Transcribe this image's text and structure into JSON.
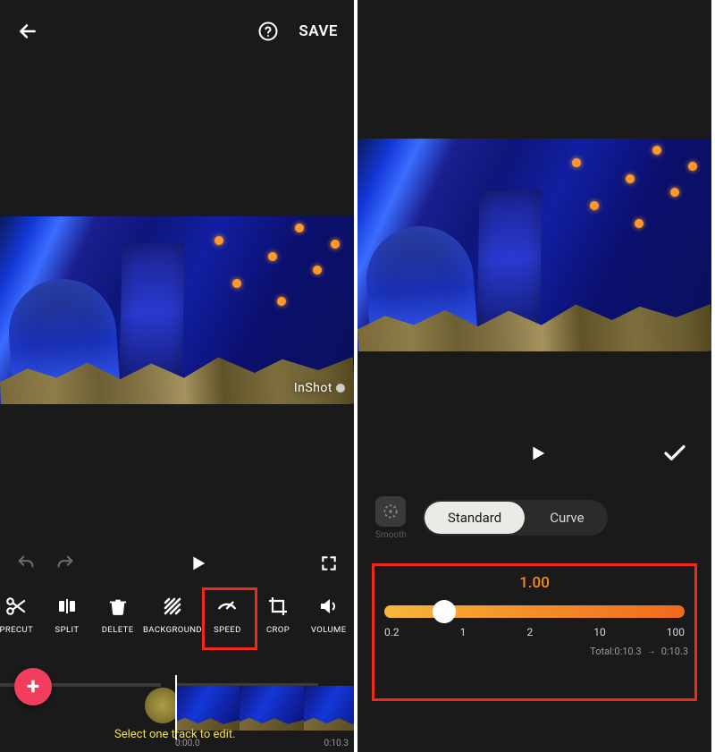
{
  "left": {
    "save_label": "SAVE",
    "watermark": "InShot",
    "tools": [
      {
        "label": "PRECUT"
      },
      {
        "label": "SPLIT"
      },
      {
        "label": "DELETE"
      },
      {
        "label": "BACKGROUND"
      },
      {
        "label": "SPEED"
      },
      {
        "label": "CROP"
      },
      {
        "label": "VOLUME"
      }
    ],
    "hint": "Select one track to edit.",
    "time_start": "0:00.0",
    "time_end": "0:10.3"
  },
  "right": {
    "smooth_label": "Smooth",
    "segments": {
      "standard": "Standard",
      "curve": "Curve",
      "active": "standard"
    },
    "speed_value": "1.00",
    "ticks": [
      "0.2",
      "1",
      "2",
      "10",
      "100"
    ],
    "slider_percent": 20,
    "total_before": "Total:0:10.3",
    "total_after": "0:10.3"
  }
}
